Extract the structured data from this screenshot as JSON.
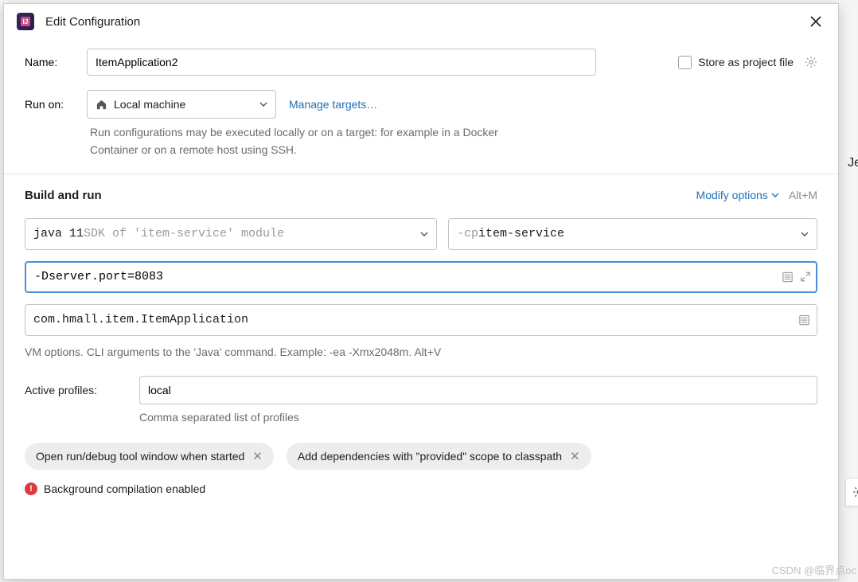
{
  "dialog": {
    "title": "Edit Configuration"
  },
  "name": {
    "label": "Name:",
    "value": "ItemApplication2"
  },
  "store_as_project_file": "Store as project file",
  "run_on": {
    "label": "Run on:",
    "value": "Local machine",
    "manage_link": "Manage targets…",
    "hint": "Run configurations may be executed locally or on a target: for example in a Docker Container or on a remote host using SSH."
  },
  "build_run": {
    "title": "Build and run",
    "modify_options": "Modify options",
    "shortcut": "Alt+M",
    "sdk": {
      "value": "java 11",
      "suffix": " SDK of 'item-service' module"
    },
    "cp": {
      "prefix": "-cp ",
      "value": "item-service"
    },
    "vm_options": "-Dserver.port=8083",
    "main_class": "com.hmall.item.ItemApplication",
    "help": "VM options. CLI arguments to the 'Java' command. Example: -ea -Xmx2048m. Alt+V"
  },
  "profiles": {
    "label": "Active profiles:",
    "value": "local",
    "hint": "Comma separated list of profiles"
  },
  "chips": {
    "tool_window": "Open run/debug tool window when started",
    "provided": "Add dependencies with \"provided\" scope to classpath"
  },
  "warning": "Background compilation enabled",
  "peek": "Je",
  "watermark": "CSDN @临界点oc"
}
